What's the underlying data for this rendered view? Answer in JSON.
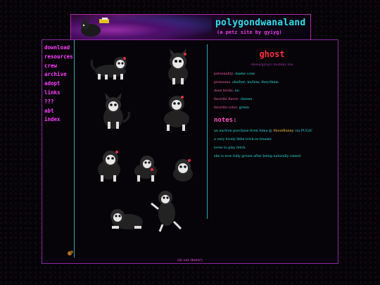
{
  "banner": {
    "title": "polygondwanaland",
    "subtitle": "(a petz site by gyiyg)"
  },
  "nav": {
    "items": [
      "download",
      "resources",
      "crew",
      "archive",
      "adopt",
      "links",
      "???",
      "abt",
      "index"
    ]
  },
  "pet": {
    "name": "ghost",
    "tagline": "Alexis/gyiyg's mommy doe",
    "fields": [
      {
        "key": "personality:",
        "value": "mame cone"
      },
      {
        "key": "pronouns:",
        "value": "she/her; he/him; they/them"
      },
      {
        "key": "does tricks:",
        "value": "no"
      },
      {
        "key": "favorite flavor:",
        "value": "cheese"
      },
      {
        "key": "favorite color:",
        "value": "green"
      }
    ]
  },
  "notes": {
    "heading": "notes:",
    "items": [
      {
        "text_before": "an auction purchase from Alma @ ",
        "link": "MoonBunny",
        "text_after": " via PUGS!"
      },
      {
        "text_before": "a very lovely little trick-or-treater.",
        "link": "",
        "text_after": ""
      },
      {
        "text_before": "loves to play fetch.",
        "link": "",
        "text_after": ""
      },
      {
        "text_before": "she is now fully grown after being naturally raised",
        "link": "",
        "text_after": ""
      }
    ]
  },
  "footer": {
    "text": "(hi out there!)"
  },
  "colors": {
    "cyan": "#2fe0e8",
    "magenta": "#ff40ff",
    "red": "#ff3040",
    "border": "#8a2aa0"
  }
}
